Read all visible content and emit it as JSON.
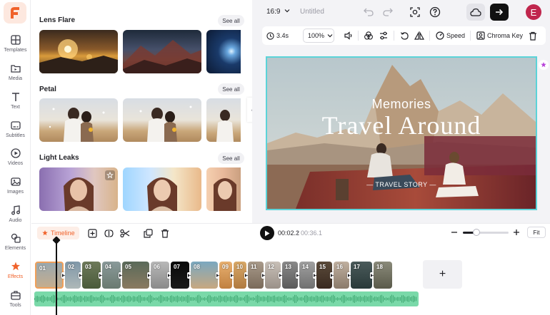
{
  "sidebar": {
    "items": [
      {
        "label": "Templates",
        "icon": "templates-icon"
      },
      {
        "label": "Media",
        "icon": "folder-icon"
      },
      {
        "label": "Text",
        "icon": "text-icon"
      },
      {
        "label": "Subtitles",
        "icon": "subtitles-icon"
      },
      {
        "label": "Videos",
        "icon": "video-icon"
      },
      {
        "label": "Images",
        "icon": "image-icon"
      },
      {
        "label": "Audio",
        "icon": "music-icon"
      },
      {
        "label": "Elements",
        "icon": "shapes-icon"
      },
      {
        "label": "Effects",
        "icon": "effects-icon",
        "active": true
      },
      {
        "label": "Tools",
        "icon": "toolbox-icon"
      }
    ]
  },
  "effects_panel": {
    "sections": [
      {
        "title": "Lens Flare",
        "see_all": "See all"
      },
      {
        "title": "Petal",
        "see_all": "See all"
      },
      {
        "title": "Light Leaks",
        "see_all": "See all"
      }
    ]
  },
  "topbar": {
    "aspect_ratio": "16:9",
    "project_title_placeholder": "Untitled",
    "avatar_letter": "E"
  },
  "clip_toolbar": {
    "duration": "3.4s",
    "zoom": "100%",
    "speed": "Speed",
    "chroma_key": "Chroma Key"
  },
  "canvas": {
    "headline_small": "Memories",
    "headline_big": "Travel Around",
    "subtitle": "— TRAVEL STORY —"
  },
  "timeline": {
    "tab_label": "Timeline",
    "current_time": "00:02.2",
    "separator": "/",
    "total_time": "00:36.1",
    "zoom_level": 0.3,
    "fit_label": "Fit",
    "add_label": "+",
    "clips": [
      "01",
      "02",
      "03",
      "04",
      "05",
      "06",
      "07",
      "08",
      "09",
      "10",
      "11",
      "12",
      "13",
      "14",
      "15",
      "16",
      "17",
      "18"
    ]
  },
  "colors": {
    "accent": "#f0622a",
    "selection": "#5bd3d8",
    "audio": "#7ad9a9",
    "avatar": "#c0264d"
  }
}
